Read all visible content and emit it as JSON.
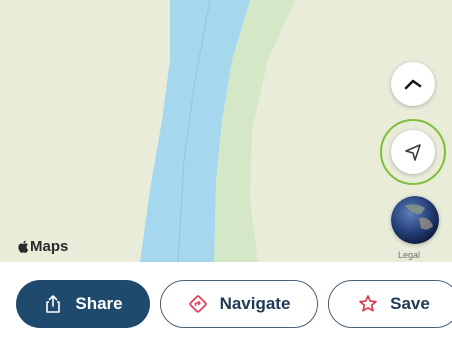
{
  "map": {
    "attribution_label": "Maps",
    "legal_label": "Legal",
    "colors": {
      "land": "#e8ecd9",
      "river": "#a5d8ee",
      "park": "#d4e8c8",
      "highlight_ring": "#7fbf3c"
    },
    "controls": {
      "compass_icon": "compass-chevron-icon",
      "locate_icon": "location-arrow-icon",
      "globe_icon": "globe-icon"
    }
  },
  "actions": {
    "share_label": "Share",
    "navigate_label": "Navigate",
    "save_label": "Save",
    "colors": {
      "primary": "#1f4a6e",
      "navigate_icon": "#e0455e",
      "save_icon": "#d8344f"
    }
  }
}
